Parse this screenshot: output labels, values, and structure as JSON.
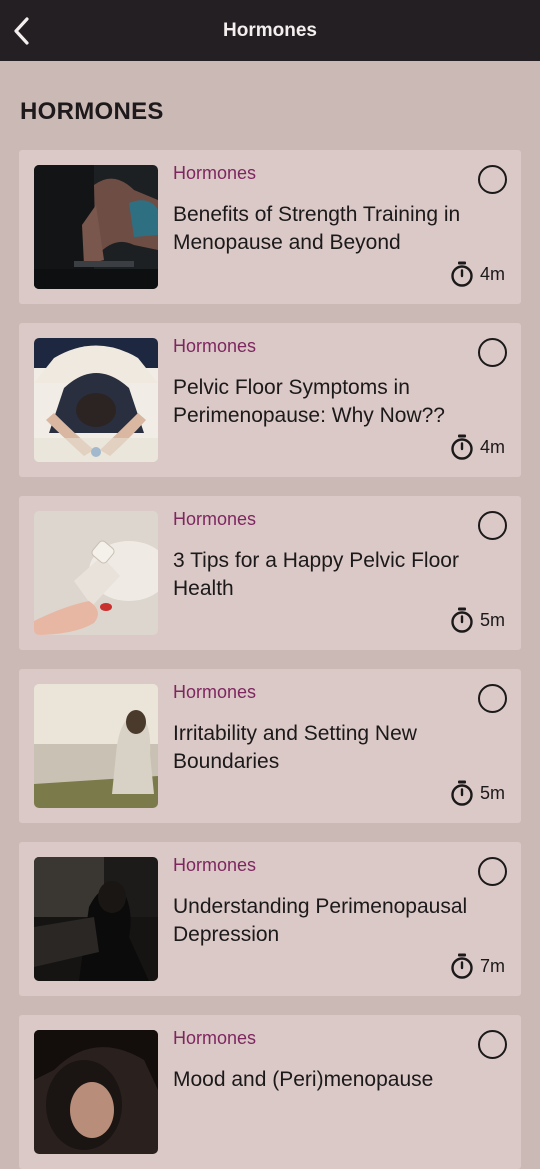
{
  "header": {
    "title": "Hormones",
    "back_icon": "chevron-left-icon"
  },
  "section": {
    "heading": "HORMONES"
  },
  "articles": [
    {
      "category": "Hormones",
      "title": "Benefits of Strength Training in Menopause and Beyond",
      "duration": "4m",
      "image": "woman doing plank exercise"
    },
    {
      "category": "Hormones",
      "title": "Pelvic Floor Symptoms in Perimenopause: Why Now??",
      "duration": "4m",
      "image": "person lying face down on bed"
    },
    {
      "category": "Hormones",
      "title": "3 Tips for a Happy Pelvic Floor Health",
      "duration": "5m",
      "image": "hand holding lotion bottle"
    },
    {
      "category": "Hormones",
      "title": "Irritability and Setting New Boundaries",
      "duration": "5m",
      "image": "woman sitting by the sea at sunset"
    },
    {
      "category": "Hormones",
      "title": "Understanding Perimenopausal Depression",
      "duration": "7m",
      "image": "woman sitting in dark room"
    },
    {
      "category": "Hormones",
      "title": "Mood and (Peri)menopause",
      "duration": "",
      "image": "portrait of woman with dark hair"
    }
  ],
  "colors": {
    "topbar": "#231f22",
    "background": "#cbb9b6",
    "card": "#dac9c6",
    "category": "#7e2660"
  }
}
